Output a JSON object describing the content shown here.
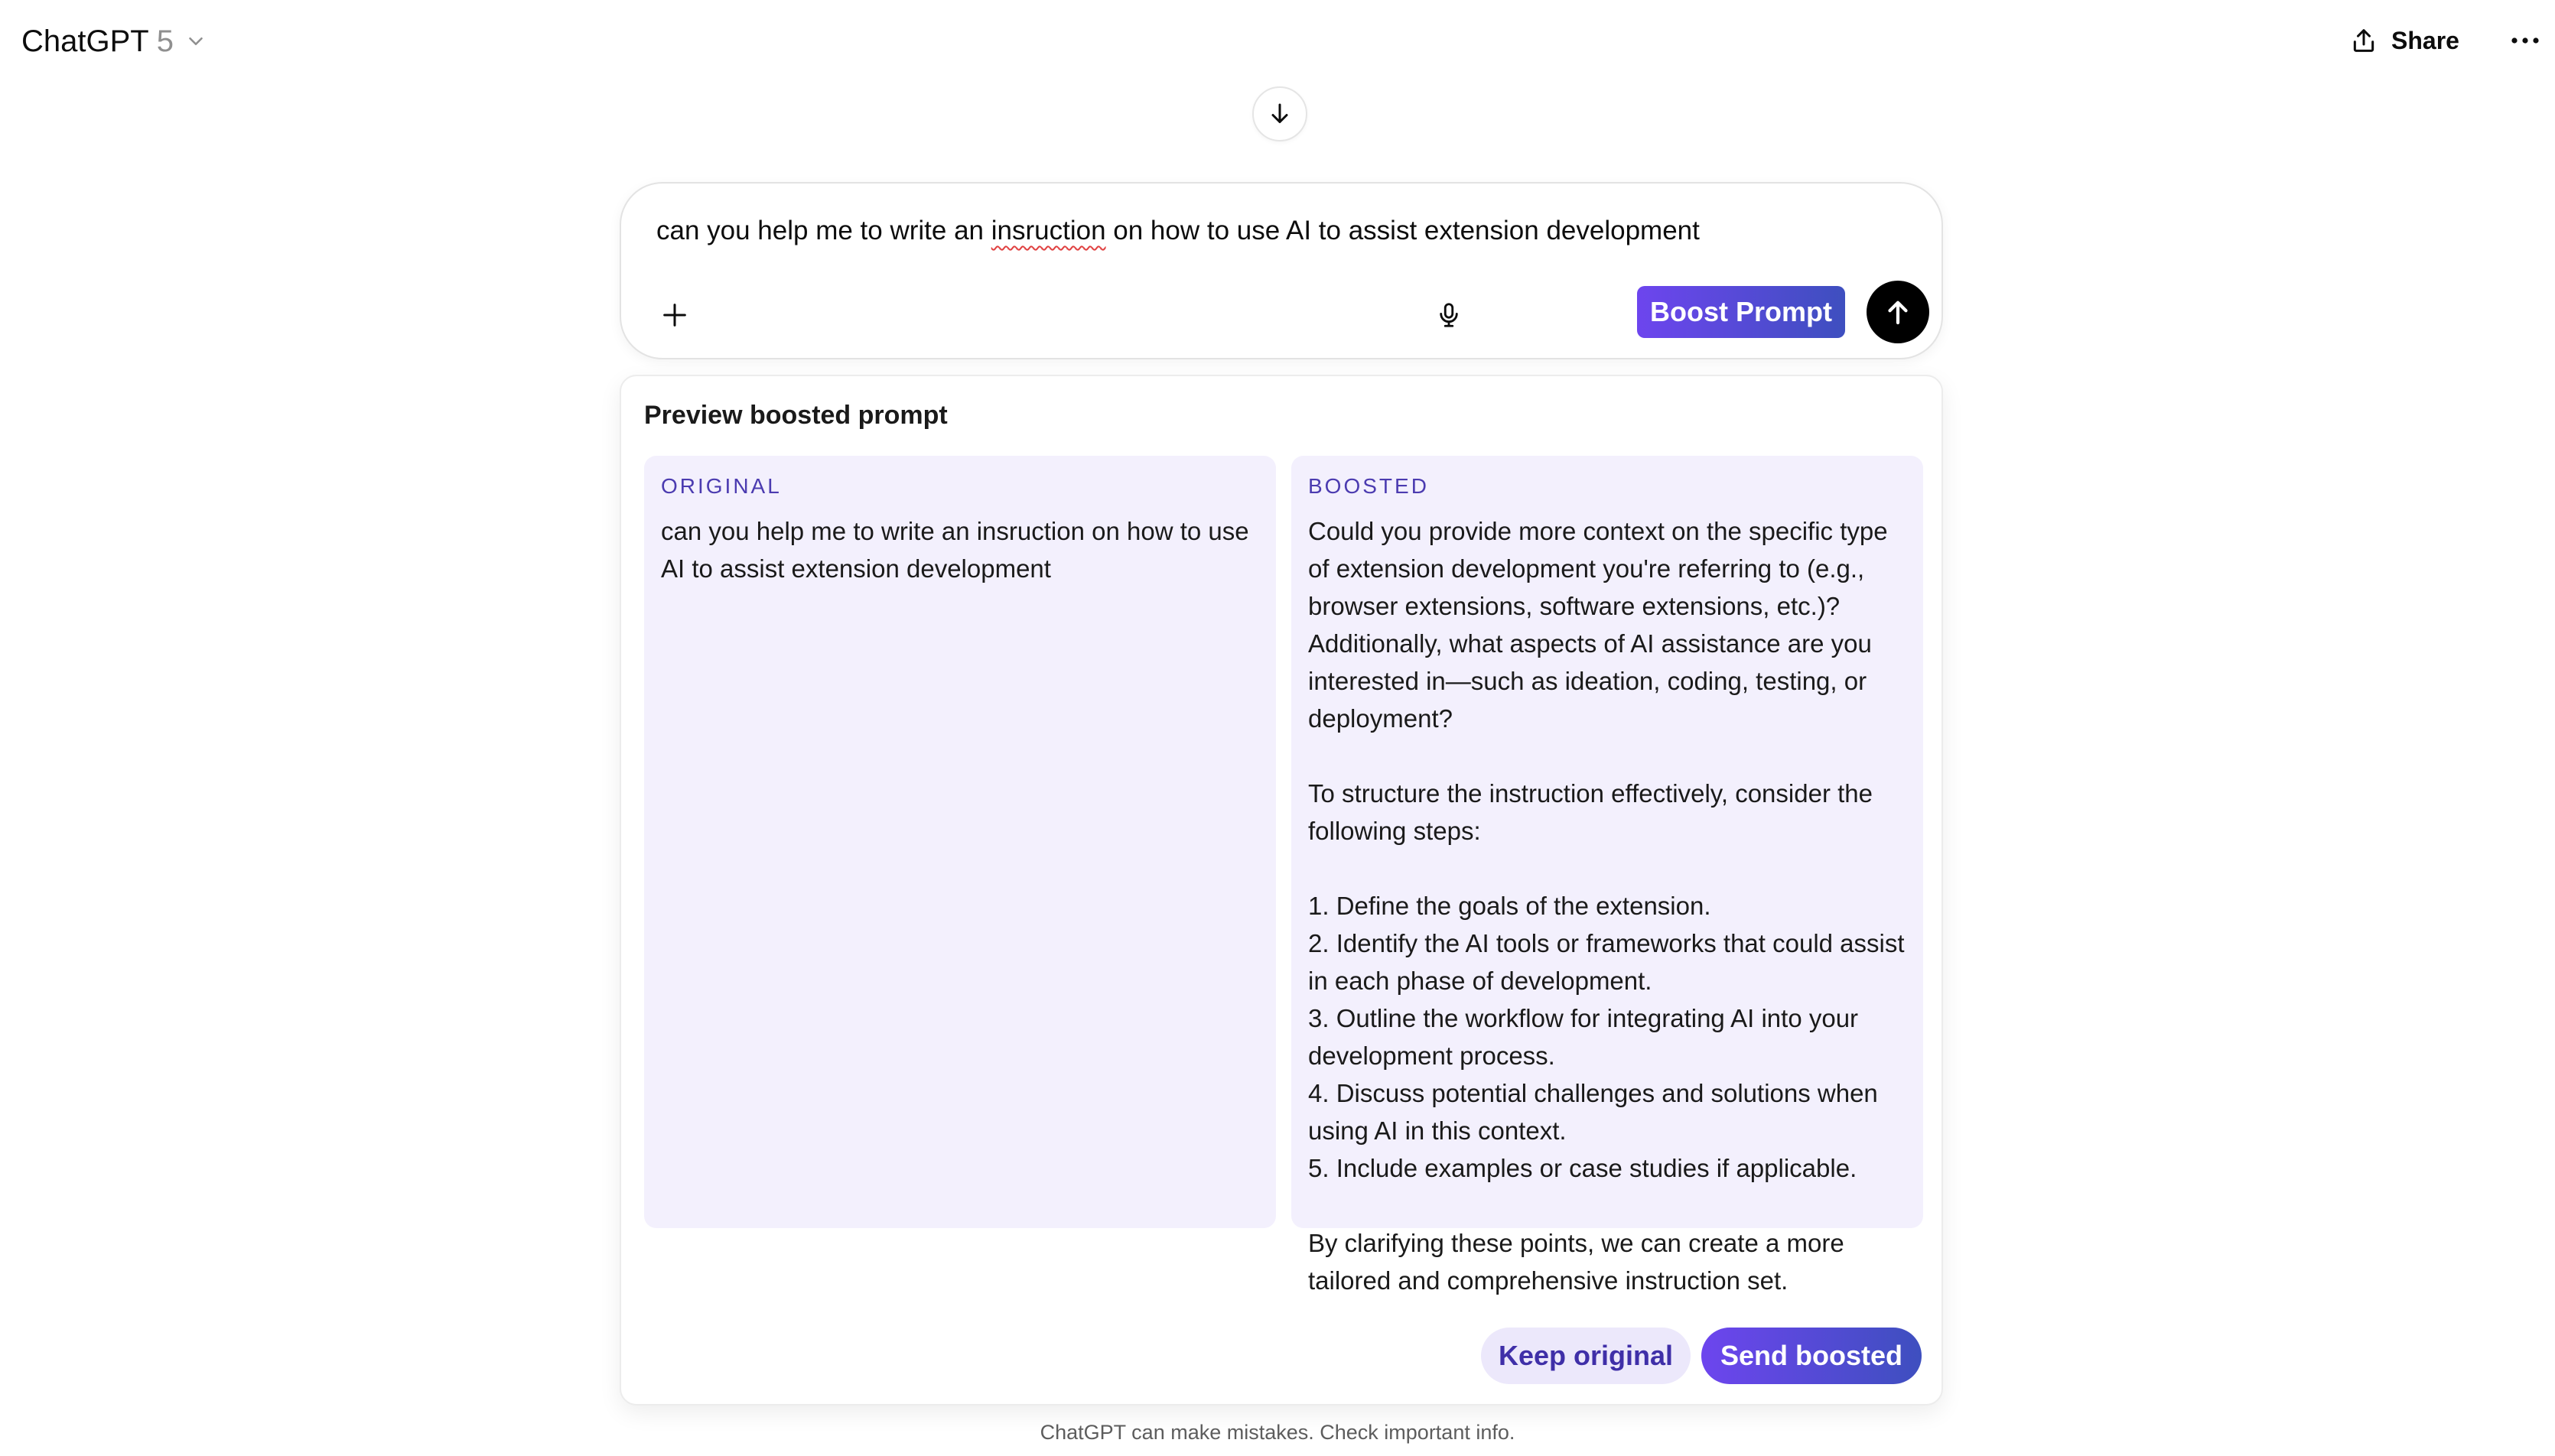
{
  "header": {
    "model_name": "ChatGPT",
    "model_version": "5",
    "share_label": "Share",
    "icons": [
      "chevron-down-icon",
      "share-icon",
      "more-icon"
    ]
  },
  "composer": {
    "text_before": "can you help me to write an ",
    "text_misspelled": "insruction",
    "text_after": " on how to use AI to assist extension development",
    "boost_label": "Boost Prompt",
    "icons": [
      "plus-icon",
      "mic-icon",
      "arrow-up-icon"
    ]
  },
  "scroll_down_icon": "arrow-down-icon",
  "preview": {
    "title": "Preview boosted prompt",
    "original_label": "ORIGINAL",
    "original_text": "can you help me to write an insruction on how to use AI to assist extension development",
    "boosted_label": "BOOSTED",
    "boosted_text": "Could you provide more context on the specific type of extension development you're referring to (e.g., browser extensions, software extensions, etc.)? Additionally, what aspects of AI assistance are you interested in—such as ideation, coding, testing, or deployment?\n\nTo structure the instruction effectively, consider the following steps:\n\n1. Define the goals of the extension.\n2. Identify the AI tools or frameworks that could assist in each phase of development.\n3. Outline the workflow for integrating AI into your development process.\n4. Discuss potential challenges and solutions when using AI in this context.\n5. Include examples or case studies if applicable.\n\nBy clarifying these points, we can create a more tailored and comprehensive instruction set.",
    "keep_label": "Keep original",
    "send_label": "Send boosted"
  },
  "footer": {
    "note": "ChatGPT can make mistakes. Check important info."
  },
  "colors": {
    "accent_start": "#6d45ee",
    "accent_end": "#3e4fbf",
    "panel_bg": "#f3f0fd",
    "label_color": "#4b3bb0"
  }
}
